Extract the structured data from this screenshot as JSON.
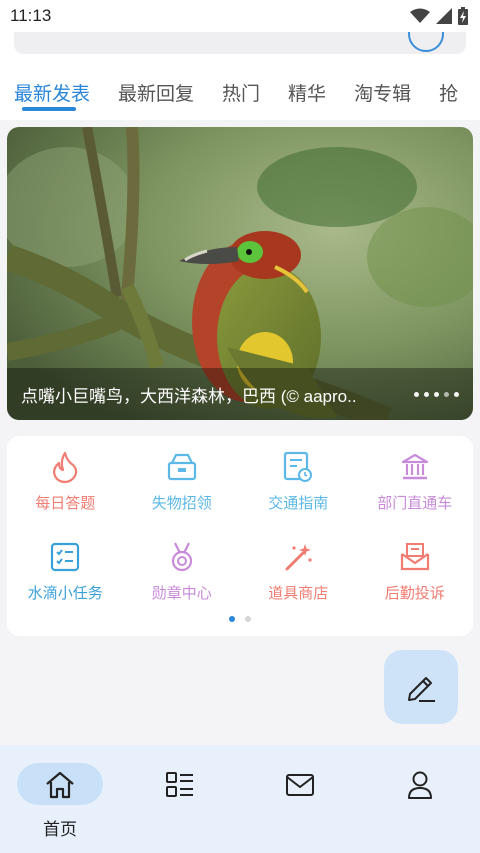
{
  "status_bar": {
    "time": "11:13"
  },
  "tabs": [
    {
      "label": "最新发表",
      "active": true
    },
    {
      "label": "最新回复",
      "active": false
    },
    {
      "label": "热门",
      "active": false
    },
    {
      "label": "精华",
      "active": false
    },
    {
      "label": "淘专辑",
      "active": false
    },
    {
      "label": "抢",
      "active": false
    }
  ],
  "banner": {
    "caption": "点嘴小巨嘴鸟，大西洋森林，巴西 (© aapro.."
  },
  "grid": [
    {
      "label": "每日答题",
      "icon": "flame-icon",
      "color": "#f07c72"
    },
    {
      "label": "失物招领",
      "icon": "lost-found-box-icon",
      "color": "#5cb8e6"
    },
    {
      "label": "交通指南",
      "icon": "schedule-doc-icon",
      "color": "#5cb8e6"
    },
    {
      "label": "部门直通车",
      "icon": "bank-building-icon",
      "color": "#c98bd9"
    },
    {
      "label": "水滴小任务",
      "icon": "task-list-icon",
      "color": "#3aa0d8"
    },
    {
      "label": "勋章中心",
      "icon": "medal-icon",
      "color": "#c98bd9"
    },
    {
      "label": "道具商店",
      "icon": "magic-wand-icon",
      "color": "#f07c72"
    },
    {
      "label": "后勤投诉",
      "icon": "complaint-mail-icon",
      "color": "#f07c72"
    }
  ],
  "bottom_nav": [
    {
      "label": "首页",
      "icon": "home-icon",
      "active": true
    },
    {
      "label": "",
      "icon": "list-icon",
      "active": false
    },
    {
      "label": "",
      "icon": "mail-icon",
      "active": false
    },
    {
      "label": "",
      "icon": "profile-icon",
      "active": false
    }
  ],
  "colors": {
    "accent": "#2a86d9",
    "fab_bg": "#cfe3f8",
    "nav_bg": "#e8f1fb"
  }
}
